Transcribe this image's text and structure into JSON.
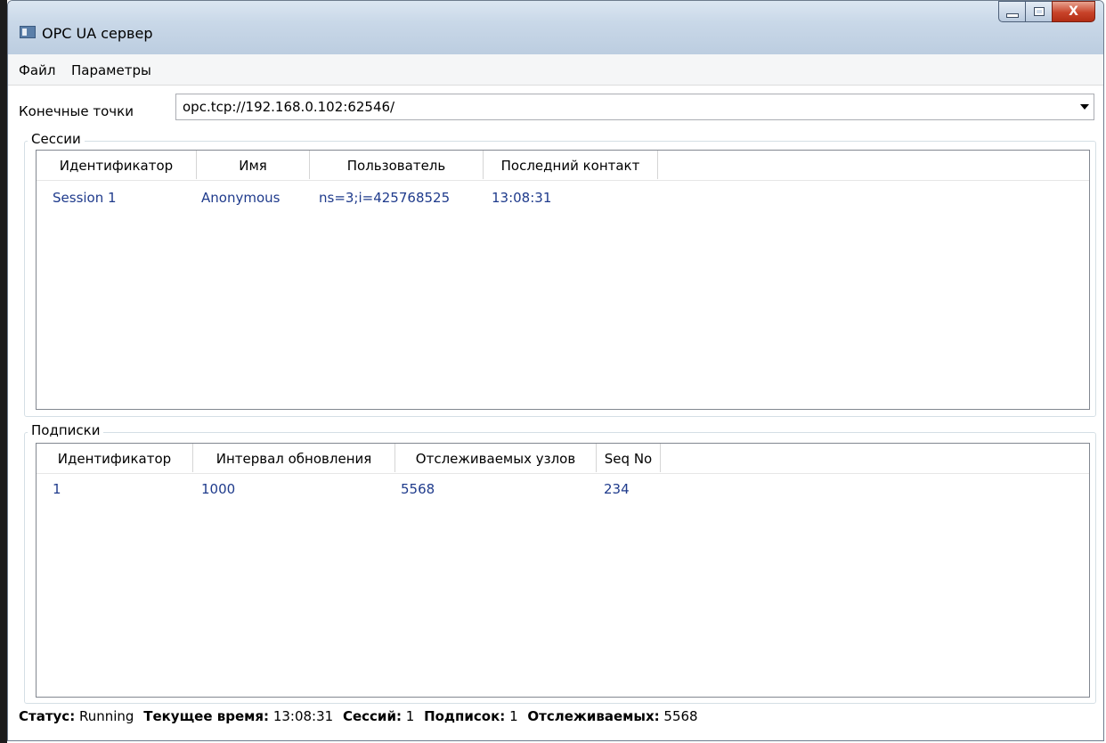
{
  "window": {
    "title": "OPC UA сервер",
    "close_glyph": "X"
  },
  "menu": [
    "Файл",
    "Параметры"
  ],
  "endpoints": {
    "label": "Конечные точки",
    "value": "opc.tcp://192.168.0.102:62546/"
  },
  "sessions": {
    "title": "Сессии",
    "columns": [
      "Идентификатор",
      "Имя",
      "Пользователь",
      "Последний контакт"
    ],
    "rows": [
      [
        "Session 1",
        "Anonymous",
        "ns=3;i=425768525",
        "13:08:31"
      ]
    ]
  },
  "subscriptions": {
    "title": "Подписки",
    "columns": [
      "Идентификатор",
      "Интервал обновления",
      "Отслеживаемых узлов",
      "Seq No"
    ],
    "rows": [
      [
        "1",
        "1000",
        "5568",
        "234"
      ]
    ]
  },
  "status": {
    "status_label": "Статус:",
    "status_value": "Running",
    "time_label": "Текущее время:",
    "time_value": "13:08:31",
    "sessions_label": "Сессий:",
    "sessions_value": "1",
    "subs_label": "Подписок:",
    "subs_value": "1",
    "monitored_label": "Отслеживаемых:",
    "monitored_value": "5568"
  }
}
